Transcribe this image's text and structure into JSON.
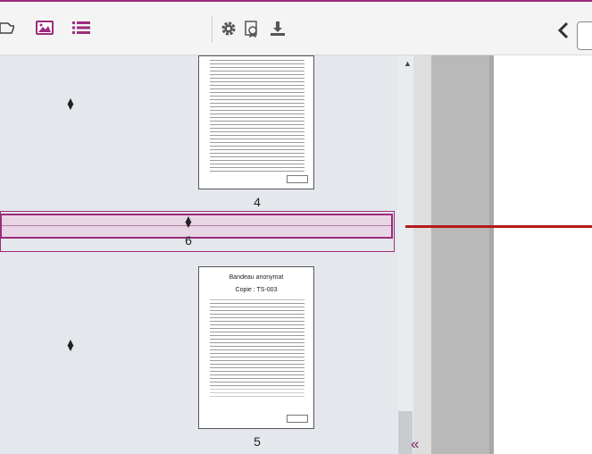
{
  "toolbar": {
    "left_icons": [
      "open-file-icon",
      "image-icon",
      "list-icon"
    ],
    "mid_icons": [
      "gear-icon",
      "certificate-icon",
      "download-icon"
    ],
    "nav_prev_icon": "chevron-left-icon"
  },
  "thumbnails": [
    {
      "page_number": "4"
    },
    {
      "page_number": "5",
      "header_title": "Bandeau anonymat",
      "header_copy": "Copie : TS-003"
    }
  ],
  "drop_indicator": {
    "label": "6"
  },
  "panel": {
    "collapse_icon": "«"
  },
  "colors": {
    "accent": "#9c2c7c",
    "indicator_line": "#b41a1a"
  }
}
